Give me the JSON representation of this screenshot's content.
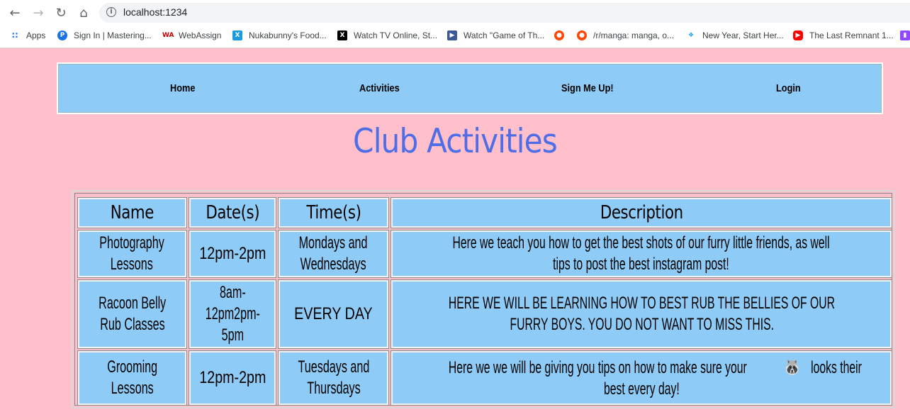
{
  "browser": {
    "url": "localhost:1234",
    "bookmarks": [
      {
        "label": "Apps",
        "icon": "apps-grid-icon",
        "color": "#1a73e8"
      },
      {
        "label": "Sign In | Mastering...",
        "icon": "mastering-icon",
        "color": "#1a73e8"
      },
      {
        "label": "WebAssign",
        "icon": "webassign-icon",
        "color": "#c00000"
      },
      {
        "label": "Nukabunny's Food...",
        "icon": "food-icon",
        "color": "#1a9be0"
      },
      {
        "label": "Watch TV Online, St...",
        "icon": "x-icon",
        "color": "#000000"
      },
      {
        "label": "Watch \"Game of Th...",
        "icon": "clapper-icon",
        "color": "#3b5998"
      },
      {
        "label": "",
        "icon": "reddit-icon",
        "color": "#ff4500"
      },
      {
        "label": "/r/manga: manga, o...",
        "icon": "reddit-icon",
        "color": "#ff4500"
      },
      {
        "label": "New Year, Start Her...",
        "icon": "bird-icon",
        "color": "#1da1f2"
      },
      {
        "label": "The Last Remnant 1...",
        "icon": "youtube-icon",
        "color": "#ff0000"
      },
      {
        "label": "",
        "icon": "twitch-icon",
        "color": "#9146ff"
      }
    ]
  },
  "nav": {
    "home": "Home",
    "activities": "Activities",
    "signup": "Sign Me Up!",
    "login": "Login"
  },
  "page": {
    "title": "Club Activities"
  },
  "table": {
    "headers": [
      "Name",
      "Date(s)",
      "Time(s)",
      "Description"
    ],
    "rows": [
      {
        "name": [
          "Photography",
          "Lessons"
        ],
        "date": [
          "12pm-2pm"
        ],
        "time": [
          "Mondays and",
          "Wednesdays"
        ],
        "description": [
          "Here we teach you how to get the best shots of our furry little friends, as well",
          "tips to post the best instagram post!"
        ]
      },
      {
        "name": [
          "Racoon Belly",
          "Rub Classes"
        ],
        "date": [
          "8am-",
          "12pm2pm-",
          "5pm"
        ],
        "time": [
          "EVERY DAY"
        ],
        "description": [
          "HERE WE WILL BE LEARNING HOW TO BEST RUB THE BELLIES OF OUR",
          "FURRY BOYS. YOU DO NOT WANT TO MISS THIS."
        ]
      },
      {
        "name": [
          "Grooming",
          "Lessons"
        ],
        "date": [
          "12pm-2pm"
        ],
        "time": [
          "Tuesdays and",
          "Thursdays"
        ],
        "description_before": "Here we we will be giving you tips on how to make sure your",
        "description_emoji": "🦝",
        "description_after": "looks their",
        "description_line2": "best every day!"
      }
    ]
  },
  "colors": {
    "page_bg": "#ffbfcb",
    "cell_bg": "#8ecbf6",
    "title": "#4d6ee6"
  }
}
